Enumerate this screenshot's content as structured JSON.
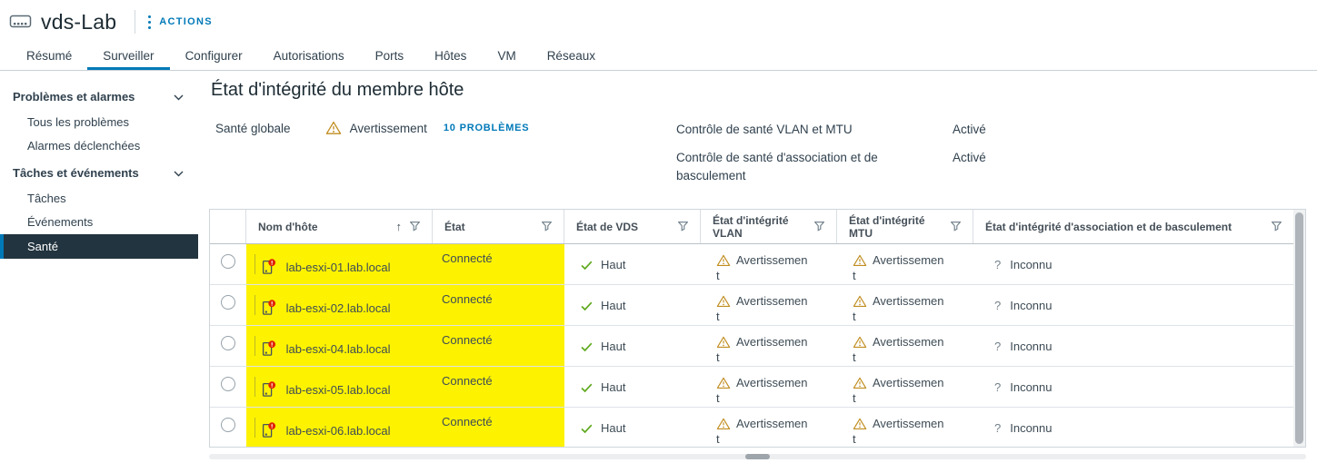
{
  "window": {
    "title": "vds-Lab",
    "actions_label": "ACTIONS"
  },
  "tabs": [
    {
      "label": "Résumé"
    },
    {
      "label": "Surveiller"
    },
    {
      "label": "Configurer"
    },
    {
      "label": "Autorisations"
    },
    {
      "label": "Ports"
    },
    {
      "label": "Hôtes"
    },
    {
      "label": "VM"
    },
    {
      "label": "Réseaux"
    }
  ],
  "active_tab": "Surveiller",
  "sidebar": {
    "groups": [
      {
        "label": "Problèmes et alarmes",
        "items": [
          {
            "label": "Tous les problèmes"
          },
          {
            "label": "Alarmes déclenchées"
          }
        ]
      },
      {
        "label": "Tâches et événements",
        "items": [
          {
            "label": "Tâches"
          },
          {
            "label": "Événements"
          }
        ]
      }
    ],
    "selected_item": {
      "label": "Santé"
    }
  },
  "main": {
    "title": "État d'intégrité du membre hôte",
    "overall_health": {
      "label": "Santé globale",
      "status": "Avertissement",
      "issues_link": "10 PROBLÈMES"
    },
    "checks": [
      {
        "label": "Contrôle de santé VLAN et MTU",
        "value": "Activé"
      },
      {
        "label": "Contrôle de santé d'association et de basculement",
        "value": "Activé"
      }
    ]
  },
  "table": {
    "columns": [
      "Nom d'hôte",
      "État",
      "État de VDS",
      "État d'intégrité VLAN",
      "État d'intégrité MTU",
      "État d'intégrité d'association et de basculement"
    ],
    "rows": [
      {
        "host": "lab-esxi-01.lab.local",
        "state": "Connecté",
        "vds_state": "Haut",
        "vlan_health": "Avertissement",
        "mtu_health": "Avertissement",
        "teaming_health": "Inconnu"
      },
      {
        "host": "lab-esxi-02.lab.local",
        "state": "Connecté",
        "vds_state": "Haut",
        "vlan_health": "Avertissement",
        "mtu_health": "Avertissement",
        "teaming_health": "Inconnu"
      },
      {
        "host": "lab-esxi-04.lab.local",
        "state": "Connecté",
        "vds_state": "Haut",
        "vlan_health": "Avertissement",
        "mtu_health": "Avertissement",
        "teaming_health": "Inconnu"
      },
      {
        "host": "lab-esxi-05.lab.local",
        "state": "Connecté",
        "vds_state": "Haut",
        "vlan_health": "Avertissement",
        "mtu_health": "Avertissement",
        "teaming_health": "Inconnu"
      },
      {
        "host": "lab-esxi-06.lab.local",
        "state": "Connecté",
        "vds_state": "Haut",
        "vlan_health": "Avertissement",
        "mtu_health": "Avertissement",
        "teaming_health": "Inconnu"
      }
    ]
  },
  "icons": {
    "sort_ascending": "↑",
    "unknown_glyph": "?"
  },
  "colors": {
    "accent": "#0079B8",
    "warning": "#C08C1E",
    "success": "#5FA91F",
    "error_badge": "#E12200",
    "row_highlight": "#FDF200",
    "selected_nav_bg": "#22343F"
  }
}
